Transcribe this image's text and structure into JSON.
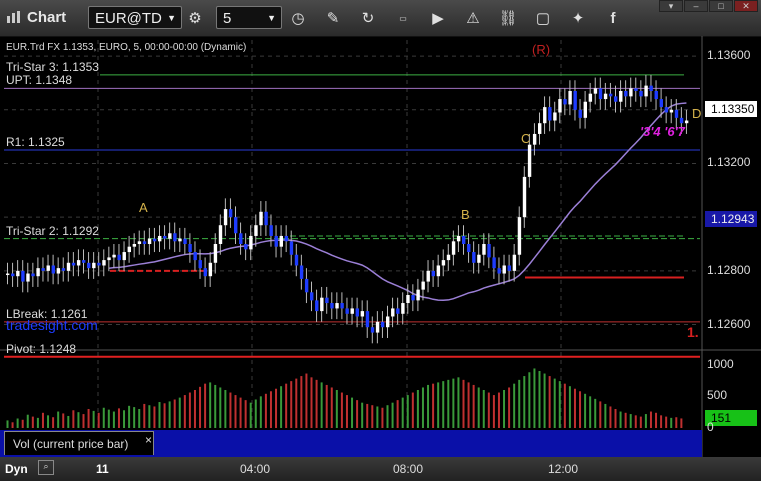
{
  "app": {
    "title": "Chart",
    "symbol": "EUR@TD",
    "interval": "5"
  },
  "toolbar_icons": [
    "settings-gear-icon",
    "clock-icon",
    "pencil-draw-icon",
    "refresh-icon",
    "hotkey-icon",
    "play-icon",
    "alert-icon",
    "link-icon",
    "chat-icon",
    "twitter-icon",
    "facebook-icon"
  ],
  "price_panel": {
    "legend": "EUR.Trd FX 1.1353, EURO, 5, 00:00-00:00 (Dynamic)",
    "levels": [
      {
        "name": "Tri-Star 3",
        "price": 1.1353,
        "label": "Tri-Star 3: 1.1353",
        "color": "#3cb043"
      },
      {
        "name": "UPT",
        "price": 1.1348,
        "label": "UPT: 1.1348",
        "color": "#a070c0"
      },
      {
        "name": "R1",
        "price": 1.1325,
        "label": "R1: 1.1325",
        "color": "#2a3cd8"
      },
      {
        "name": "Tri-Star 2",
        "price": 1.1292,
        "label": "Tri-Star 2: 1.1292",
        "color": "#3cb043"
      },
      {
        "name": "LBreak",
        "price": 1.1261,
        "label": "LBreak: 1.1261",
        "color": "#c03030"
      },
      {
        "name": "Pivot",
        "price": 1.1248,
        "label": "Pivot: 1.1248",
        "color": "#e02020"
      }
    ],
    "watermark": "tradesight.com",
    "r_marker": "(R)",
    "letters": [
      "A",
      "B",
      "C",
      "D"
    ],
    "right_marker": "1.",
    "last_price": "1.13350",
    "ma_value": "1.12943",
    "y_ticks": [
      "1.13600",
      "1.13400",
      "1.13200",
      "1.13000",
      "1.12800",
      "1.12600"
    ]
  },
  "volume_panel": {
    "tab_label": "Vol (current price bar)",
    "close_icon": "×",
    "y_ticks": [
      "1000",
      "500",
      "0"
    ],
    "current_volume": "151"
  },
  "x_axis": {
    "labels": [
      "11",
      "04:00",
      "08:00",
      "12:00"
    ],
    "mode": "Dyn"
  },
  "colors": {
    "up": "#ffffff",
    "down": "#1e3cff",
    "ma": "#9b7fd6",
    "vol_up": "#3a9a3a",
    "vol_down": "#c03030",
    "badge_bg": "#1818a8",
    "vol_badge": "#17c117"
  },
  "chart_data": {
    "type": "candlestick",
    "ylim": [
      1.1252,
      1.1366
    ],
    "closes": [
      1.1279,
      1.1278,
      1.128,
      1.1276,
      1.1279,
      1.1278,
      1.1281,
      1.128,
      1.1282,
      1.1279,
      1.1281,
      1.128,
      1.1283,
      1.1282,
      1.1284,
      1.1283,
      1.1281,
      1.1283,
      1.1282,
      1.1284,
      1.1285,
      1.1286,
      1.1284,
      1.1287,
      1.1289,
      1.129,
      1.1291,
      1.129,
      1.1292,
      1.1291,
      1.1293,
      1.1292,
      1.1294,
      1.1291,
      1.1292,
      1.129,
      1.1287,
      1.1284,
      1.1281,
      1.1278,
      1.1283,
      1.129,
      1.1297,
      1.1303,
      1.13,
      1.1294,
      1.129,
      1.1288,
      1.1293,
      1.1297,
      1.1302,
      1.1297,
      1.1293,
      1.1289,
      1.1293,
      1.1291,
      1.1286,
      1.1282,
      1.1277,
      1.1272,
      1.1269,
      1.1265,
      1.127,
      1.1268,
      1.1266,
      1.1268,
      1.1266,
      1.1264,
      1.1266,
      1.1263,
      1.1265,
      1.1259,
      1.1257,
      1.1261,
      1.1259,
      1.1263,
      1.1266,
      1.1264,
      1.1268,
      1.1271,
      1.1269,
      1.1273,
      1.1276,
      1.128,
      1.1278,
      1.1282,
      1.1284,
      1.1286,
      1.1291,
      1.1293,
      1.129,
      1.1287,
      1.1283,
      1.1286,
      1.129,
      1.1285,
      1.1281,
      1.1279,
      1.1282,
      1.128,
      1.1286,
      1.13,
      1.1315,
      1.1327,
      1.1331,
      1.1335,
      1.1341,
      1.1336,
      1.1339,
      1.1344,
      1.1342,
      1.1347,
      1.134,
      1.1337,
      1.1343,
      1.1346,
      1.1348,
      1.1344,
      1.1346,
      1.1345,
      1.1343,
      1.1347,
      1.1345,
      1.1348,
      1.1347,
      1.1345,
      1.1349,
      1.1347,
      1.1344,
      1.1341,
      1.1339,
      1.134,
      1.1337,
      1.1335,
      1.1336
    ],
    "volume": [
      120,
      90,
      150,
      130,
      210,
      180,
      160,
      240,
      200,
      170,
      260,
      230,
      190,
      280,
      250,
      220,
      300,
      270,
      240,
      320,
      290,
      260,
      310,
      280,
      350,
      330,
      300,
      380,
      360,
      340,
      410,
      390,
      420,
      450,
      480,
      520,
      560,
      600,
      650,
      700,
      720,
      680,
      640,
      600,
      560,
      520,
      480,
      440,
      400,
      450,
      500,
      540,
      580,
      620,
      660,
      700,
      740,
      780,
      820,
      860,
      800,
      760,
      720,
      680,
      640,
      600,
      560,
      520,
      480,
      440,
      400,
      380,
      360,
      340,
      320,
      360,
      400,
      440,
      480,
      520,
      560,
      600,
      640,
      680,
      700,
      720,
      740,
      760,
      780,
      800,
      760,
      720,
      680,
      640,
      600,
      560,
      520,
      560,
      600,
      640,
      700,
      760,
      820,
      880,
      940,
      900,
      860,
      820,
      780,
      740,
      700,
      660,
      620,
      580,
      540,
      500,
      460,
      420,
      380,
      340,
      300,
      260,
      240,
      220,
      200,
      180,
      220,
      260,
      240,
      200,
      180,
      160,
      170,
      151
    ]
  }
}
